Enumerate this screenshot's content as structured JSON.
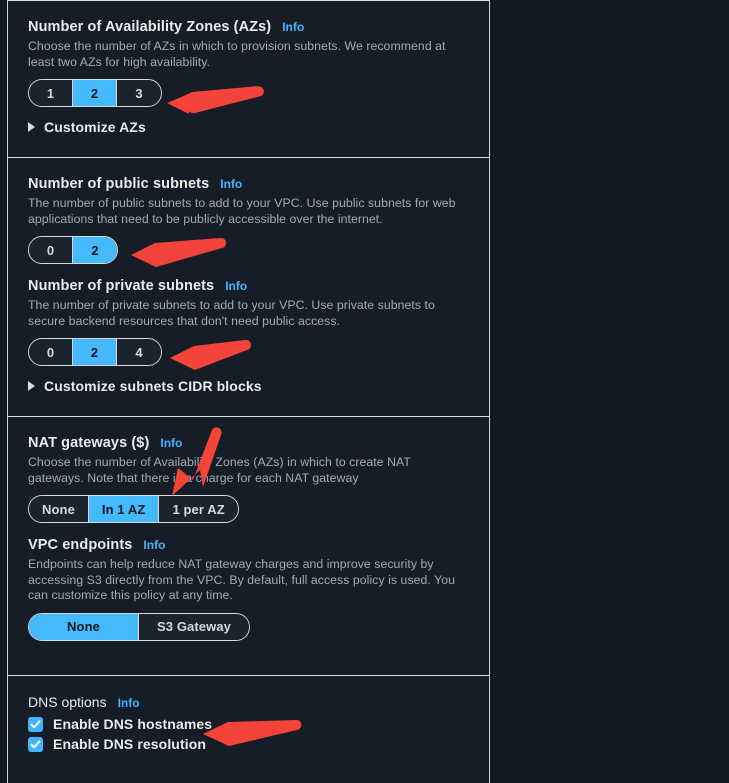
{
  "panel": {
    "sections": [
      {
        "id": "azs",
        "label": "Number of Availability Zones (AZs)",
        "info": "Info",
        "description": "Choose the number of AZs in which to provision subnets. We recommend at least two AZs for high availability.",
        "options": [
          "1",
          "2",
          "3"
        ],
        "selected": "2",
        "expander": "Customize AZs"
      },
      {
        "id": "public-subnets",
        "label": "Number of public subnets",
        "info": "Info",
        "description": "The number of public subnets to add to your VPC. Use public subnets for web applications that need to be publicly accessible over the internet.",
        "options": [
          "0",
          "2"
        ],
        "selected": "2"
      },
      {
        "id": "private-subnets",
        "label": "Number of private subnets",
        "info": "Info",
        "description": "The number of private subnets to add to your VPC. Use private subnets to secure backend resources that don't need public access.",
        "options": [
          "0",
          "2",
          "4"
        ],
        "selected": "2",
        "expander": "Customize subnets CIDR blocks"
      },
      {
        "id": "nat-gateways",
        "label": "NAT gateways ($)",
        "info": "Info",
        "description": "Choose the number of Availability Zones (AZs) in which to create NAT gateways. Note that there is a charge for each NAT gateway",
        "options": [
          "None",
          "In 1 AZ",
          "1 per AZ"
        ],
        "selected": "In 1 AZ"
      },
      {
        "id": "vpc-endpoints",
        "label": "VPC endpoints",
        "info": "Info",
        "description": "Endpoints can help reduce NAT gateway charges and improve security by accessing S3 directly from the VPC. By default, full access policy is used. You can customize this policy at any time.",
        "options": [
          "None",
          "S3 Gateway"
        ],
        "selected": "None"
      },
      {
        "id": "dns-options",
        "label": "DNS options",
        "info": "Info",
        "checkboxes": [
          {
            "label": "Enable DNS hostnames",
            "checked": true
          },
          {
            "label": "Enable DNS resolution",
            "checked": true
          }
        ]
      }
    ]
  },
  "annotations": {
    "arrow_color": "#f44336",
    "arrows": [
      {
        "name": "arrow-to-az-selector"
      },
      {
        "name": "arrow-to-public-subnets-selector"
      },
      {
        "name": "arrow-to-private-subnets-selector"
      },
      {
        "name": "arrow-to-nat-gateways-description"
      },
      {
        "name": "arrow-to-enable-dns-hostnames"
      }
    ]
  },
  "colors": {
    "accent_blue": "#42b4ff",
    "selected_segment": "#44b9fd",
    "panel_background": "#161d26",
    "page_background": "#131a23",
    "border": "#d5d9e0",
    "text_primary": "#e9ebed",
    "text_secondary": "#a4abb6"
  }
}
